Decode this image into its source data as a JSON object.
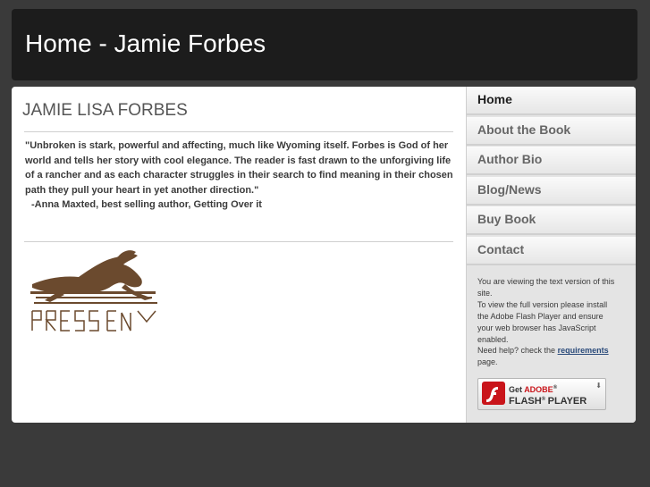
{
  "header": {
    "title": "Home - Jamie Forbes"
  },
  "main": {
    "title": "JAMIE LISA FORBES",
    "quote": "\"Unbroken is stark, powerful and affecting, much like Wyoming itself. Forbes is God of her world and tells her story with cool elegance. The reader is fast drawn to the unforgiving life of a rancher and as each character struggles in their search to find meaning in their chosen path they pull your heart in yet another direction.\"",
    "attribution": "-Anna Maxted, best selling author, Getting Over it",
    "logo": {
      "icon": "horse-logo-icon",
      "text": "PRESS",
      "color": "#6b4a2e"
    }
  },
  "nav": {
    "items": [
      {
        "label": "Home",
        "active": true
      },
      {
        "label": "About the Book",
        "active": false
      },
      {
        "label": "Author Bio",
        "active": false
      },
      {
        "label": "Blog/News",
        "active": false
      },
      {
        "label": "Buy Book",
        "active": false
      },
      {
        "label": "Contact",
        "active": false
      }
    ]
  },
  "side": {
    "line1": "You are viewing the text version of this site.",
    "line2": "To view the full version please install the Adobe Flash Player and ensure your web browser has JavaScript enabled.",
    "line3_pre": "Need help? check the",
    "requirements_link": "requirements",
    "line3_post": "page."
  },
  "flash": {
    "get": "Get",
    "brand": "ADOBE",
    "product": "FLASH",
    "player": "PLAYER",
    "icon": "flash-icon",
    "brand_color": "#c9141a"
  }
}
